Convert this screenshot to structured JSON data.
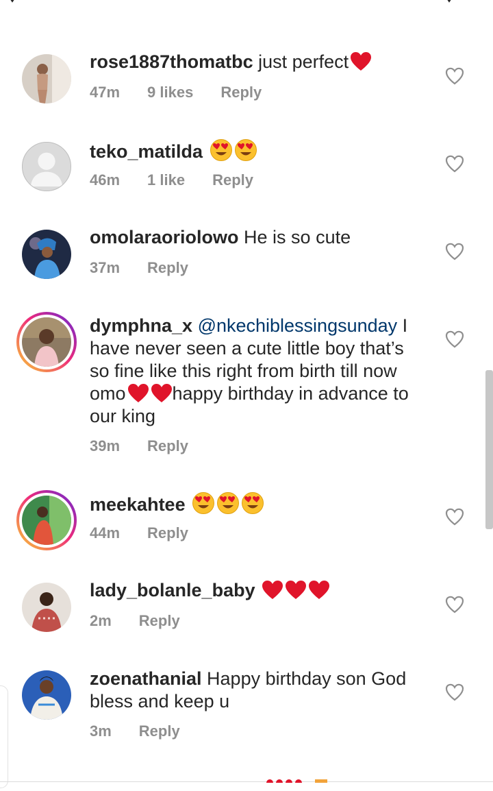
{
  "comments": [
    {
      "username": "rose1887thomatbc",
      "text": " just perfect",
      "emoji": "heart x1",
      "time": "47m",
      "likes": "9 likes",
      "reply": "Reply"
    },
    {
      "username": "teko_matilda",
      "text": " ",
      "emoji": "heart-eyes x2",
      "time": "46m",
      "likes": "1 like",
      "reply": "Reply"
    },
    {
      "username": "omolaraoriolowo",
      "text": " He is so cute",
      "time": "37m",
      "reply": "Reply"
    },
    {
      "username": "dymphna_x",
      "mention": "@nkechiblessingsunday",
      "text_a": " I have never seen a cute little boy that’s so fine like this right from birth till now omo",
      "glyph": "",
      "text_b": "happy birthday in advance to our king ",
      "time": "39m",
      "reply": "Reply"
    },
    {
      "username": "meekahtee",
      "emoji": "heart-eyes x3",
      "time": "44m",
      "reply": "Reply"
    },
    {
      "username": "lady_bolanle_baby",
      "emoji": "heart x3",
      "time": "2m",
      "reply": "Reply"
    },
    {
      "username": "zoenathanial",
      "text": " Happy birthday son God bless and keep u",
      "time": "3m",
      "reply": "Reply"
    }
  ],
  "icons": {
    "like": "heart-outline-icon",
    "heart_emoji": "red-heart-emoji",
    "heart_eyes": "heart-eyes-emoji"
  },
  "colors": {
    "username": "#262626",
    "meta": "#8e8e8e",
    "mention": "#00376b",
    "heart_emoji": "#e0142a",
    "story_ring": "#ee2a7b"
  }
}
